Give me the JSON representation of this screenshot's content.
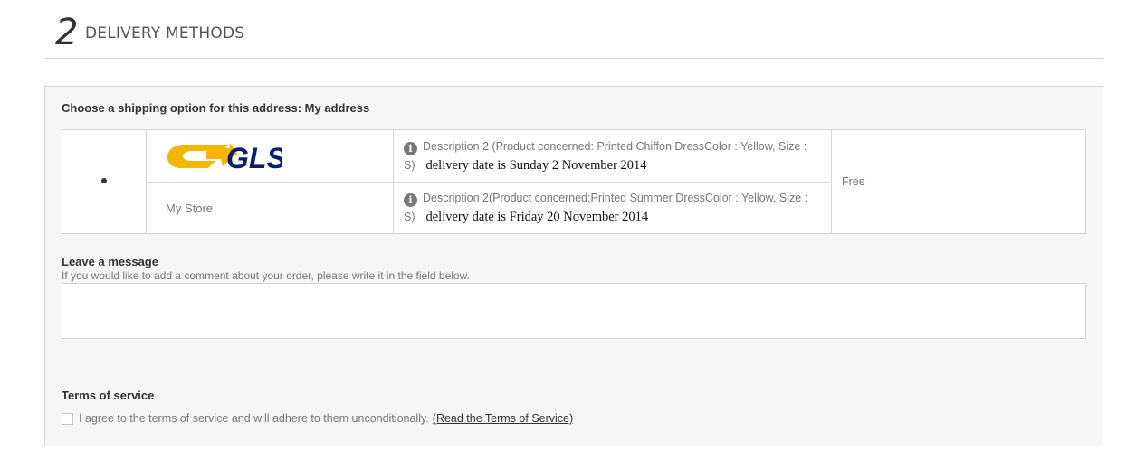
{
  "step": {
    "number": "2",
    "title": "DELIVERY METHODS"
  },
  "shipping": {
    "choose_label": "Choose a shipping option for this address: My address",
    "option": {
      "selected": true,
      "carrier_logo_text": "GLS",
      "store_name": "My Store",
      "price": "Free",
      "descriptions": [
        {
          "text": "Description 2 (Product concerned: Printed Chiffon DressColor : Yellow, Size : S)",
          "delivery": "delivery date is Sunday 2 November 2014"
        },
        {
          "text": "Description 2(Product concerned:Printed Summer DressColor : Yellow, Size : S)",
          "delivery": "delivery date is Friday 20  November 2014"
        }
      ]
    }
  },
  "message": {
    "title": "Leave a message",
    "help": "If you would like to add a comment about your order, please write it in the field below.",
    "value": ""
  },
  "terms": {
    "title": "Terms of service",
    "agree_text": "I agree to the terms of service and will adhere to them unconditionally.",
    "link_text": "(Read the Terms of Service)",
    "checked": false
  },
  "colors": {
    "gls_yellow": "#f7b500",
    "gls_blue": "#0a1f6b",
    "border": "#d6d4d4",
    "panel_bg": "#f6f6f6"
  }
}
